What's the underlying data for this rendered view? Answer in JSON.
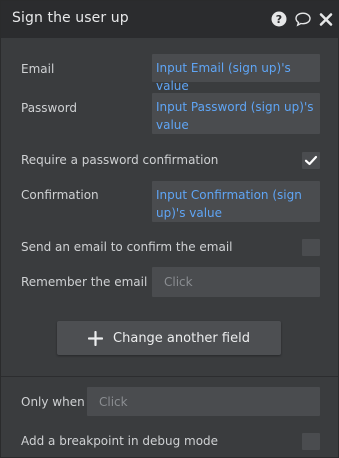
{
  "header": {
    "title": "Sign the user up",
    "help_icon": "help-icon",
    "comment_icon": "comment-icon",
    "close_icon": "close-icon"
  },
  "fields": {
    "email": {
      "label": "Email",
      "value": "Input Email (sign up)'s value"
    },
    "password": {
      "label": "Password",
      "value": "Input Password (sign up)'s value"
    },
    "require_confirmation": {
      "label": "Require a password confirmation",
      "checked": true
    },
    "confirmation": {
      "label": "Confirmation",
      "value": "Input Confirmation (sign up)'s value"
    },
    "send_email": {
      "label": "Send an email to confirm the email",
      "checked": false
    },
    "remember_email": {
      "label": "Remember the email",
      "placeholder": "Click"
    }
  },
  "change_field_button": {
    "label": "Change another field",
    "icon": "plus-icon"
  },
  "conditions": {
    "only_when": {
      "label": "Only when",
      "placeholder": "Click"
    },
    "breakpoint": {
      "label": "Add a breakpoint in debug mode",
      "checked": false
    }
  },
  "colors": {
    "header_bg": "#2b2c2e",
    "panel_bg": "#3a3c3e",
    "field_bg": "#4a4c4f",
    "dynamic_value": "#5fa5f5"
  }
}
